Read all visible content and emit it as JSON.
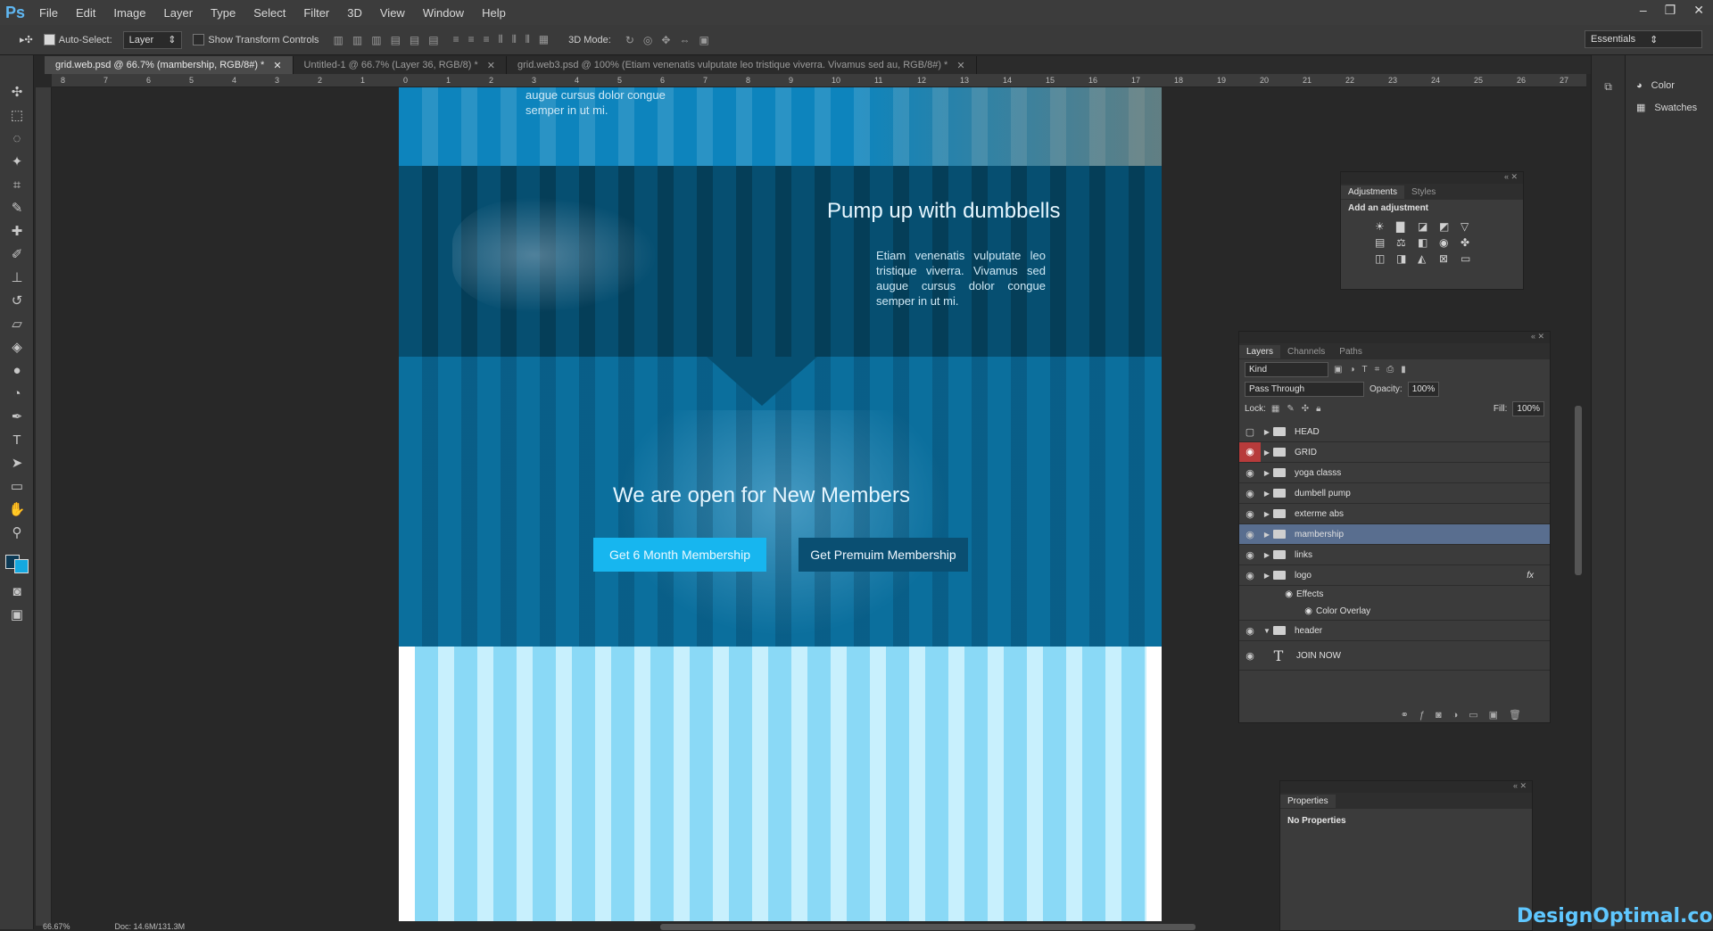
{
  "app": {
    "logo": "Ps"
  },
  "menu": [
    "File",
    "Edit",
    "Image",
    "Layer",
    "Type",
    "Select",
    "Filter",
    "3D",
    "View",
    "Window",
    "Help"
  ],
  "window_controls": [
    "–",
    "❐",
    "✕"
  ],
  "options_bar": {
    "auto_select_label": "Auto-Select:",
    "auto_select_value": "Layer",
    "show_transform_label": "Show Transform Controls",
    "mode_3d_label": "3D Mode:",
    "workspace": "Essentials"
  },
  "doc_tabs": [
    {
      "label": "grid.web.psd @ 66.7% (mambership, RGB/8#) *",
      "active": true
    },
    {
      "label": "Untitled-1 @ 66.7% (Layer 36, RGB/8) *",
      "active": false
    },
    {
      "label": "grid.web3.psd @ 100% (Etiam venenatis vulputate leo tristique viverra. Vivamus sed au, RGB/8#) *",
      "active": false
    }
  ],
  "ruler_ticks": [
    "8",
    "7",
    "6",
    "5",
    "4",
    "3",
    "2",
    "1",
    "0",
    "1",
    "2",
    "3",
    "4",
    "5",
    "6",
    "7",
    "8",
    "9",
    "10",
    "11",
    "12",
    "13",
    "14",
    "15",
    "16",
    "17",
    "18",
    "19",
    "20",
    "21",
    "22",
    "23",
    "24",
    "25",
    "26",
    "27"
  ],
  "tools": [
    "move-icon",
    "marquee-icon",
    "lasso-icon",
    "magic-wand-icon",
    "crop-icon",
    "eyedropper-icon",
    "healing-icon",
    "brush-icon",
    "stamp-icon",
    "history-brush-icon",
    "eraser-icon",
    "bucket-icon",
    "blur-icon",
    "dodge-icon",
    "pen-icon",
    "type-icon",
    "path-select-icon",
    "shape-icon",
    "hand-icon",
    "zoom-icon"
  ],
  "canvas": {
    "top_text": "augue cursus dolor congue semper in ut mi.",
    "pump_heading": "Pump up with dumbbells",
    "pump_text": "Etiam venenatis vulputate leo tristique viverra. Vivamus sed augue cursus dolor congue semper in ut mi.",
    "open_heading": "We are open for New Members",
    "btn_six_month": "Get 6 Month Membership",
    "btn_premium": "Get Premuim Membership"
  },
  "right_panel": {
    "color": "Color",
    "swatches": "Swatches"
  },
  "adjustments": {
    "tabs": [
      "Adjustments",
      "Styles"
    ],
    "title": "Add an adjustment"
  },
  "layers_panel": {
    "tabs": [
      "Layers",
      "Channels",
      "Paths"
    ],
    "kind": "Kind",
    "blend": "Pass Through",
    "opacity_label": "Opacity:",
    "opacity": "100%",
    "lock_label": "Lock:",
    "fill_label": "Fill:",
    "fill": "100%",
    "layers": [
      {
        "name": "HEAD",
        "visible": false,
        "selected": false
      },
      {
        "name": "GRID",
        "visible": true,
        "selected": false,
        "red": true
      },
      {
        "name": "yoga classs",
        "visible": true,
        "selected": false
      },
      {
        "name": "dumbell pump",
        "visible": true,
        "selected": false
      },
      {
        "name": "exterme abs",
        "visible": true,
        "selected": false
      },
      {
        "name": "mambership",
        "visible": true,
        "selected": true
      },
      {
        "name": "links",
        "visible": true,
        "selected": false
      },
      {
        "name": "logo",
        "visible": true,
        "selected": false
      }
    ],
    "effects_label": "Effects",
    "color_overlay": "Color Overlay",
    "header_layer": "header",
    "join_now": "JOIN NOW",
    "fx": "fx"
  },
  "properties": {
    "tab": "Properties",
    "text": "No Properties"
  },
  "status": {
    "zoom": "66.67%",
    "doc": "Doc: 14.6M/131.3M"
  },
  "watermark": "DesignOptimal.com"
}
